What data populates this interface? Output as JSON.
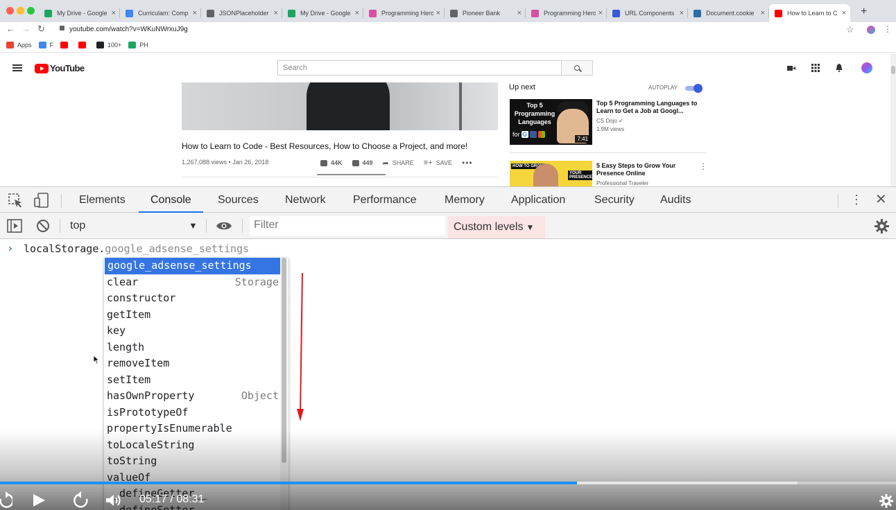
{
  "browser": {
    "tabs": [
      {
        "title": "My Drive - Google",
        "color": "#1fa463"
      },
      {
        "title": "Curriculam: Comp",
        "color": "#4285f4"
      },
      {
        "title": "JSONPlaceholder",
        "color": "#5f6368"
      },
      {
        "title": "My Drive - Google",
        "color": "#1fa463"
      },
      {
        "title": "Programming Hero",
        "color": "#d94fa0"
      },
      {
        "title": "Pioneer Bank",
        "color": "#5f6368"
      },
      {
        "title": "Programming Hero",
        "color": "#d94fa0"
      },
      {
        "title": "URL Components",
        "color": "#3b5bd6"
      },
      {
        "title": "Document.cookie",
        "color": "#2b6ea8"
      },
      {
        "title": "How to Learn to C",
        "color": "#ff0000"
      }
    ],
    "url": "youtube.com/watch?v=WKuNWrxuJ9g",
    "bookmarks": [
      {
        "label": "Apps",
        "color": "#ea4335"
      },
      {
        "label": "F",
        "color": "#4285f4"
      },
      {
        "label": "",
        "color": "#ff0000"
      },
      {
        "label": "",
        "color": "#ff0000"
      },
      {
        "label": "100+",
        "color": "#202124"
      },
      {
        "label": "PH",
        "color": "#1fa463"
      }
    ]
  },
  "youtube": {
    "logo_text": "YouTube",
    "search_placeholder": "Search",
    "video_title": "How to Learn to Code - Best Resources, How to Choose a Project, and more!",
    "video_meta": "1,267,088 views • Jan 26, 2018",
    "likes": "44K",
    "dislikes": "449",
    "share_label": "SHARE",
    "save_label": "SAVE",
    "up_next": "Up next",
    "autoplay": "AUTOPLAY",
    "recommendations": [
      {
        "thumb_text": "Top 5 Programming Languages",
        "thumb_for": "for",
        "title": "Top 5 Programming Languages to Learn to Get a Job at Googl...",
        "channel": "CS Dojo",
        "views": "1.9M views",
        "duration": "7:41"
      },
      {
        "thumb_text_1": "HOW TO GROW",
        "thumb_text_2": "YOUR PRESENCE",
        "title": "5 Easy Steps to Grow Your Presence Online",
        "channel": "Professional Traveler"
      }
    ]
  },
  "devtools": {
    "tabs": [
      "Elements",
      "Console",
      "Sources",
      "Network",
      "Performance",
      "Memory",
      "Application",
      "Security",
      "Audits"
    ],
    "active_tab": "Console",
    "context": "top",
    "filter_placeholder": "Filter",
    "levels": "Custom levels",
    "prompt_typed": "localStorage.",
    "prompt_ghost": "google_adsense_settings",
    "autocomplete": [
      {
        "label": "google_adsense_settings",
        "hint": ""
      },
      {
        "label": "clear",
        "hint": "Storage"
      },
      {
        "label": "constructor",
        "hint": ""
      },
      {
        "label": "getItem",
        "hint": ""
      },
      {
        "label": "key",
        "hint": ""
      },
      {
        "label": "length",
        "hint": ""
      },
      {
        "label": "removeItem",
        "hint": ""
      },
      {
        "label": "setItem",
        "hint": ""
      },
      {
        "label": "hasOwnProperty",
        "hint": "Object"
      },
      {
        "label": "isPrototypeOf",
        "hint": ""
      },
      {
        "label": "propertyIsEnumerable",
        "hint": ""
      },
      {
        "label": "toLocaleString",
        "hint": ""
      },
      {
        "label": "toString",
        "hint": ""
      },
      {
        "label": "valueOf",
        "hint": ""
      },
      {
        "label": "__defineGetter__",
        "hint": ""
      },
      {
        "label": "__defineSetter__",
        "hint": ""
      }
    ]
  },
  "player": {
    "time": "05:17 / 08:31",
    "progress": 0.644,
    "progress_color": "#1e90ff"
  }
}
